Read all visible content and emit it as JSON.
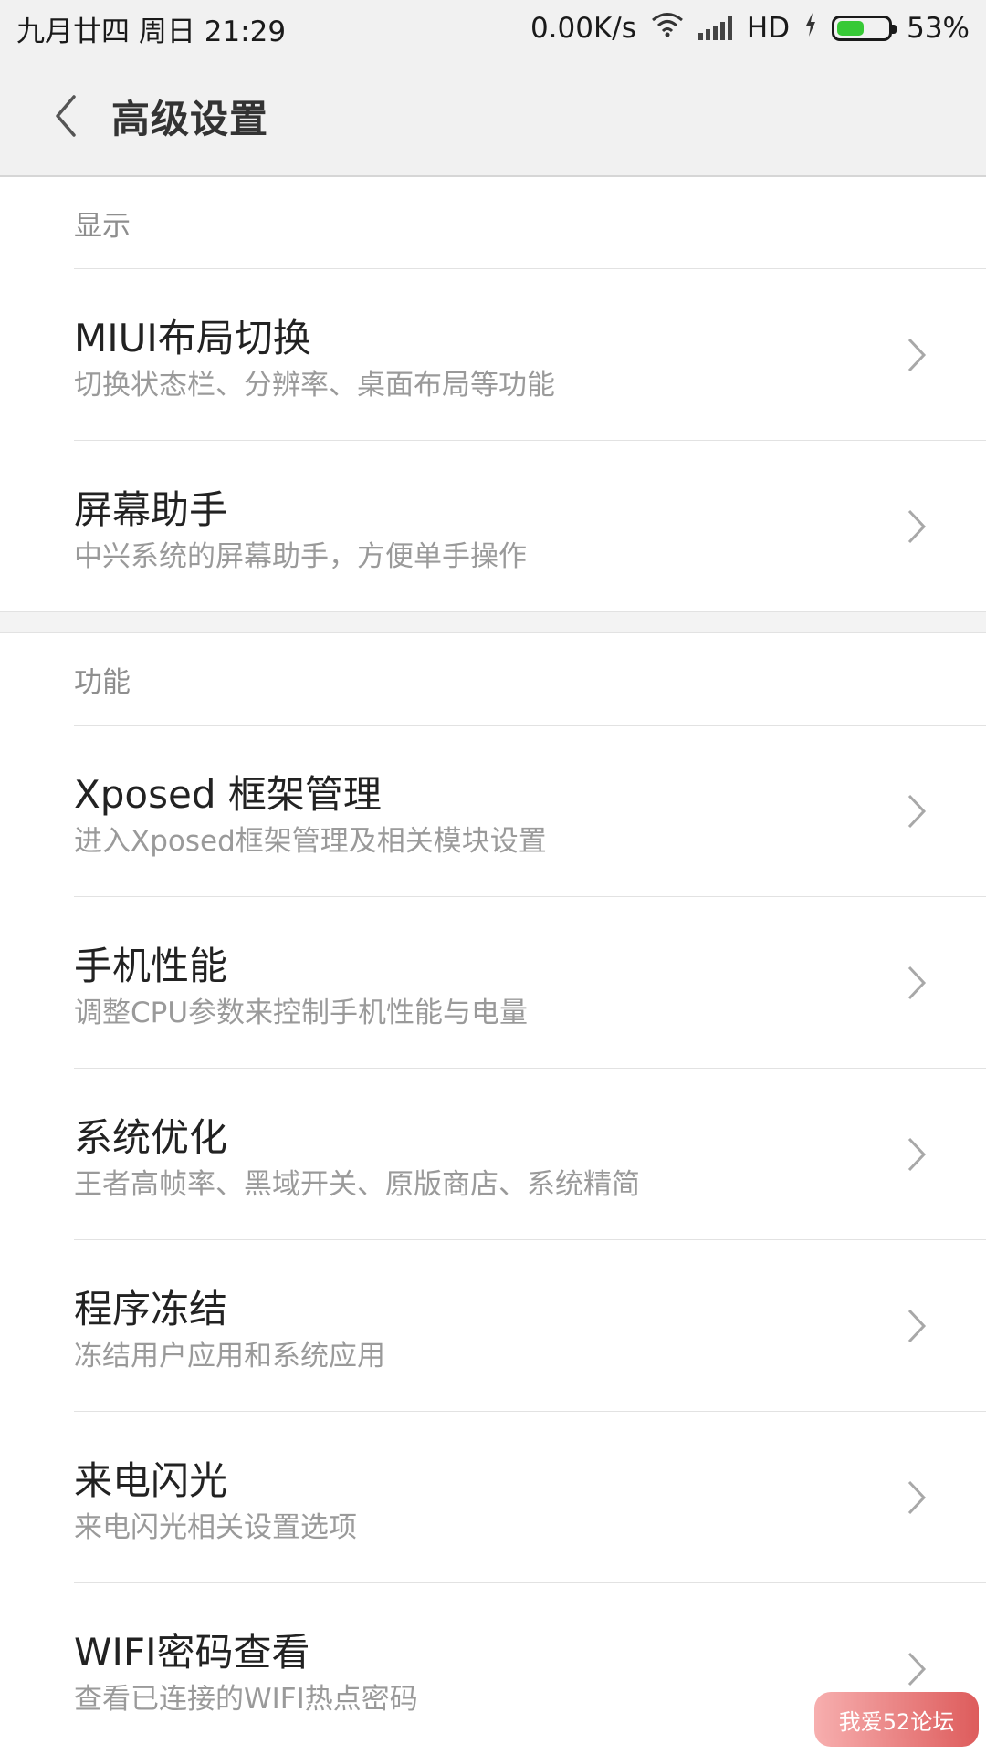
{
  "status_bar": {
    "date_time": "九月廿四  周日  21:29",
    "net_speed": "0.00K/s",
    "network_type": "HD",
    "battery_percent": "53%",
    "battery_level": 0.53,
    "battery_color": "#37c936"
  },
  "header": {
    "back_icon": "chevron-left-icon",
    "title": "高级设置"
  },
  "sections": [
    {
      "title": "显示",
      "items": [
        {
          "title": "MIUI布局切换",
          "subtitle": "切换状态栏、分辨率、桌面布局等功能"
        },
        {
          "title": "屏幕助手",
          "subtitle": "中兴系统的屏幕助手，方便单手操作"
        }
      ]
    },
    {
      "title": "功能",
      "items": [
        {
          "title": "Xposed 框架管理",
          "subtitle": "进入Xposed框架管理及相关模块设置"
        },
        {
          "title": "手机性能",
          "subtitle": "调整CPU参数来控制手机性能与电量"
        },
        {
          "title": "系统优化",
          "subtitle": "王者高帧率、黑域开关、原版商店、系统精简"
        },
        {
          "title": "程序冻结",
          "subtitle": "冻结用户应用和系统应用"
        },
        {
          "title": "来电闪光",
          "subtitle": "来电闪光相关设置选项"
        },
        {
          "title": "WIFI密码查看",
          "subtitle": "查看已连接的WIFI热点密码"
        }
      ]
    }
  ],
  "watermark": "我爱52论坛"
}
